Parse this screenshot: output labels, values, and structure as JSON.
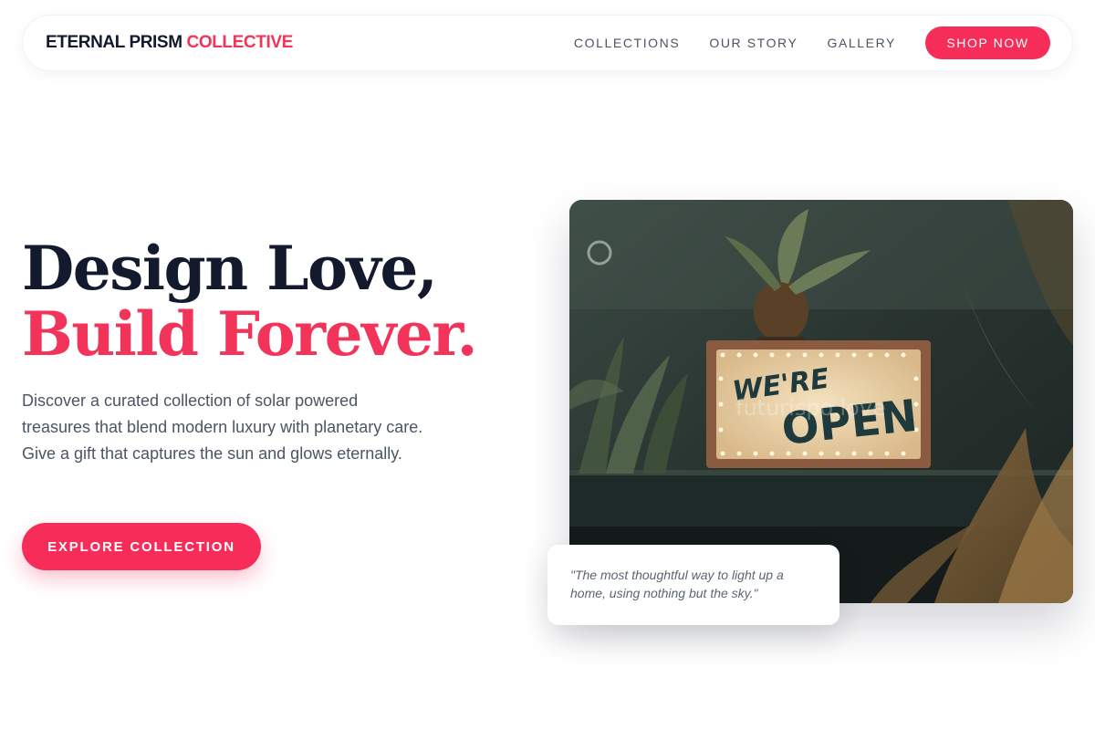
{
  "brand": {
    "name_part1": "ETERNAL PRISM",
    "name_part2": "COLLECTIVE"
  },
  "nav": {
    "links": [
      "COLLECTIONS",
      "OUR STORY",
      "GALLERY"
    ],
    "cta_label": "SHOP NOW"
  },
  "hero": {
    "headline_line1": "Design Love,",
    "headline_line2": "Build Forever.",
    "description": "Discover a curated collection of solar powered treasures that blend modern luxury with planetary care. Give a gift that captures the sun and glows eternally.",
    "cta_label": "EXPLORE COLLECTION",
    "image_sign_word1": "WE'RE",
    "image_sign_word2": "OPEN",
    "image_watermark": "futurispo.love",
    "quote": "\"The most thoughtful way to light up a home, using nothing but the sky.\""
  },
  "colors": {
    "accent": "#f62d58",
    "heading": "#141a2e",
    "body_text": "#4b5563"
  }
}
